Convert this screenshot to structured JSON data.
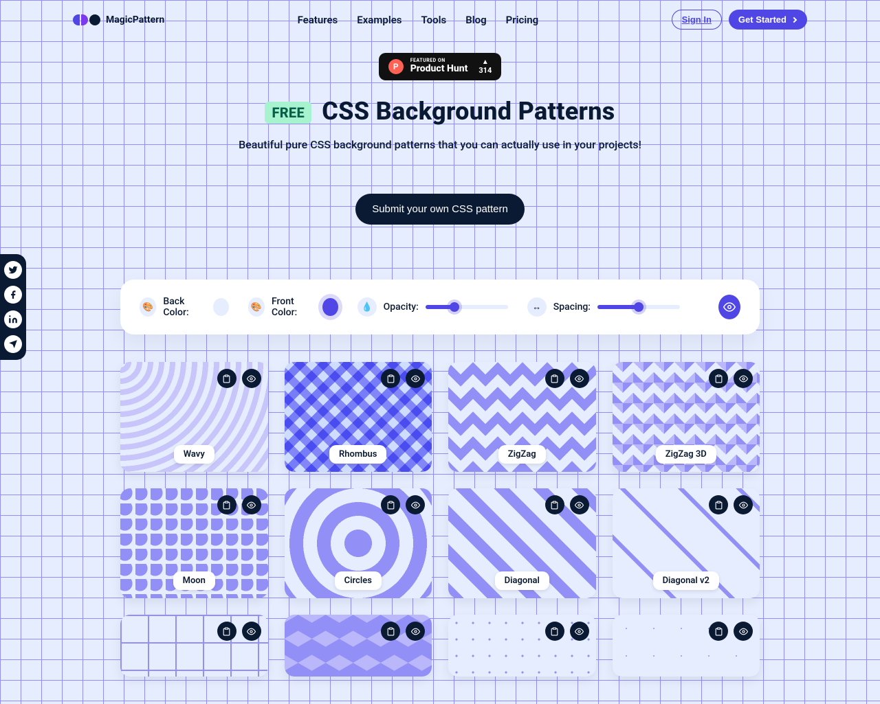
{
  "brand": "MagicPattern",
  "nav": {
    "features": "Features",
    "examples": "Examples",
    "tools": "Tools",
    "blog": "Blog",
    "pricing": "Pricing"
  },
  "actions": {
    "signin": "Sign In",
    "getstarted": "Get Started"
  },
  "producthunt": {
    "featured": "FEATURED ON",
    "name": "Product Hunt",
    "upvotes": "314"
  },
  "hero": {
    "badge": "FREE",
    "title": "CSS Background Patterns",
    "subtitle": "Beautiful pure CSS background patterns that you can actually use in your projects!",
    "submit": "Submit your own CSS pattern"
  },
  "controls": {
    "back": "Back Color:",
    "front": "Front Color:",
    "opacity": "Opacity:",
    "spacing": "Spacing:",
    "opacity_value": 35,
    "spacing_value": 50,
    "back_color": "#e5edff",
    "front_color": "#4f46e5"
  },
  "patterns": [
    {
      "name": "Wavy"
    },
    {
      "name": "Rhombus"
    },
    {
      "name": "ZigZag"
    },
    {
      "name": "ZigZag 3D"
    },
    {
      "name": "Moon"
    },
    {
      "name": "Circles"
    },
    {
      "name": "Diagonal"
    },
    {
      "name": "Diagonal v2"
    }
  ]
}
